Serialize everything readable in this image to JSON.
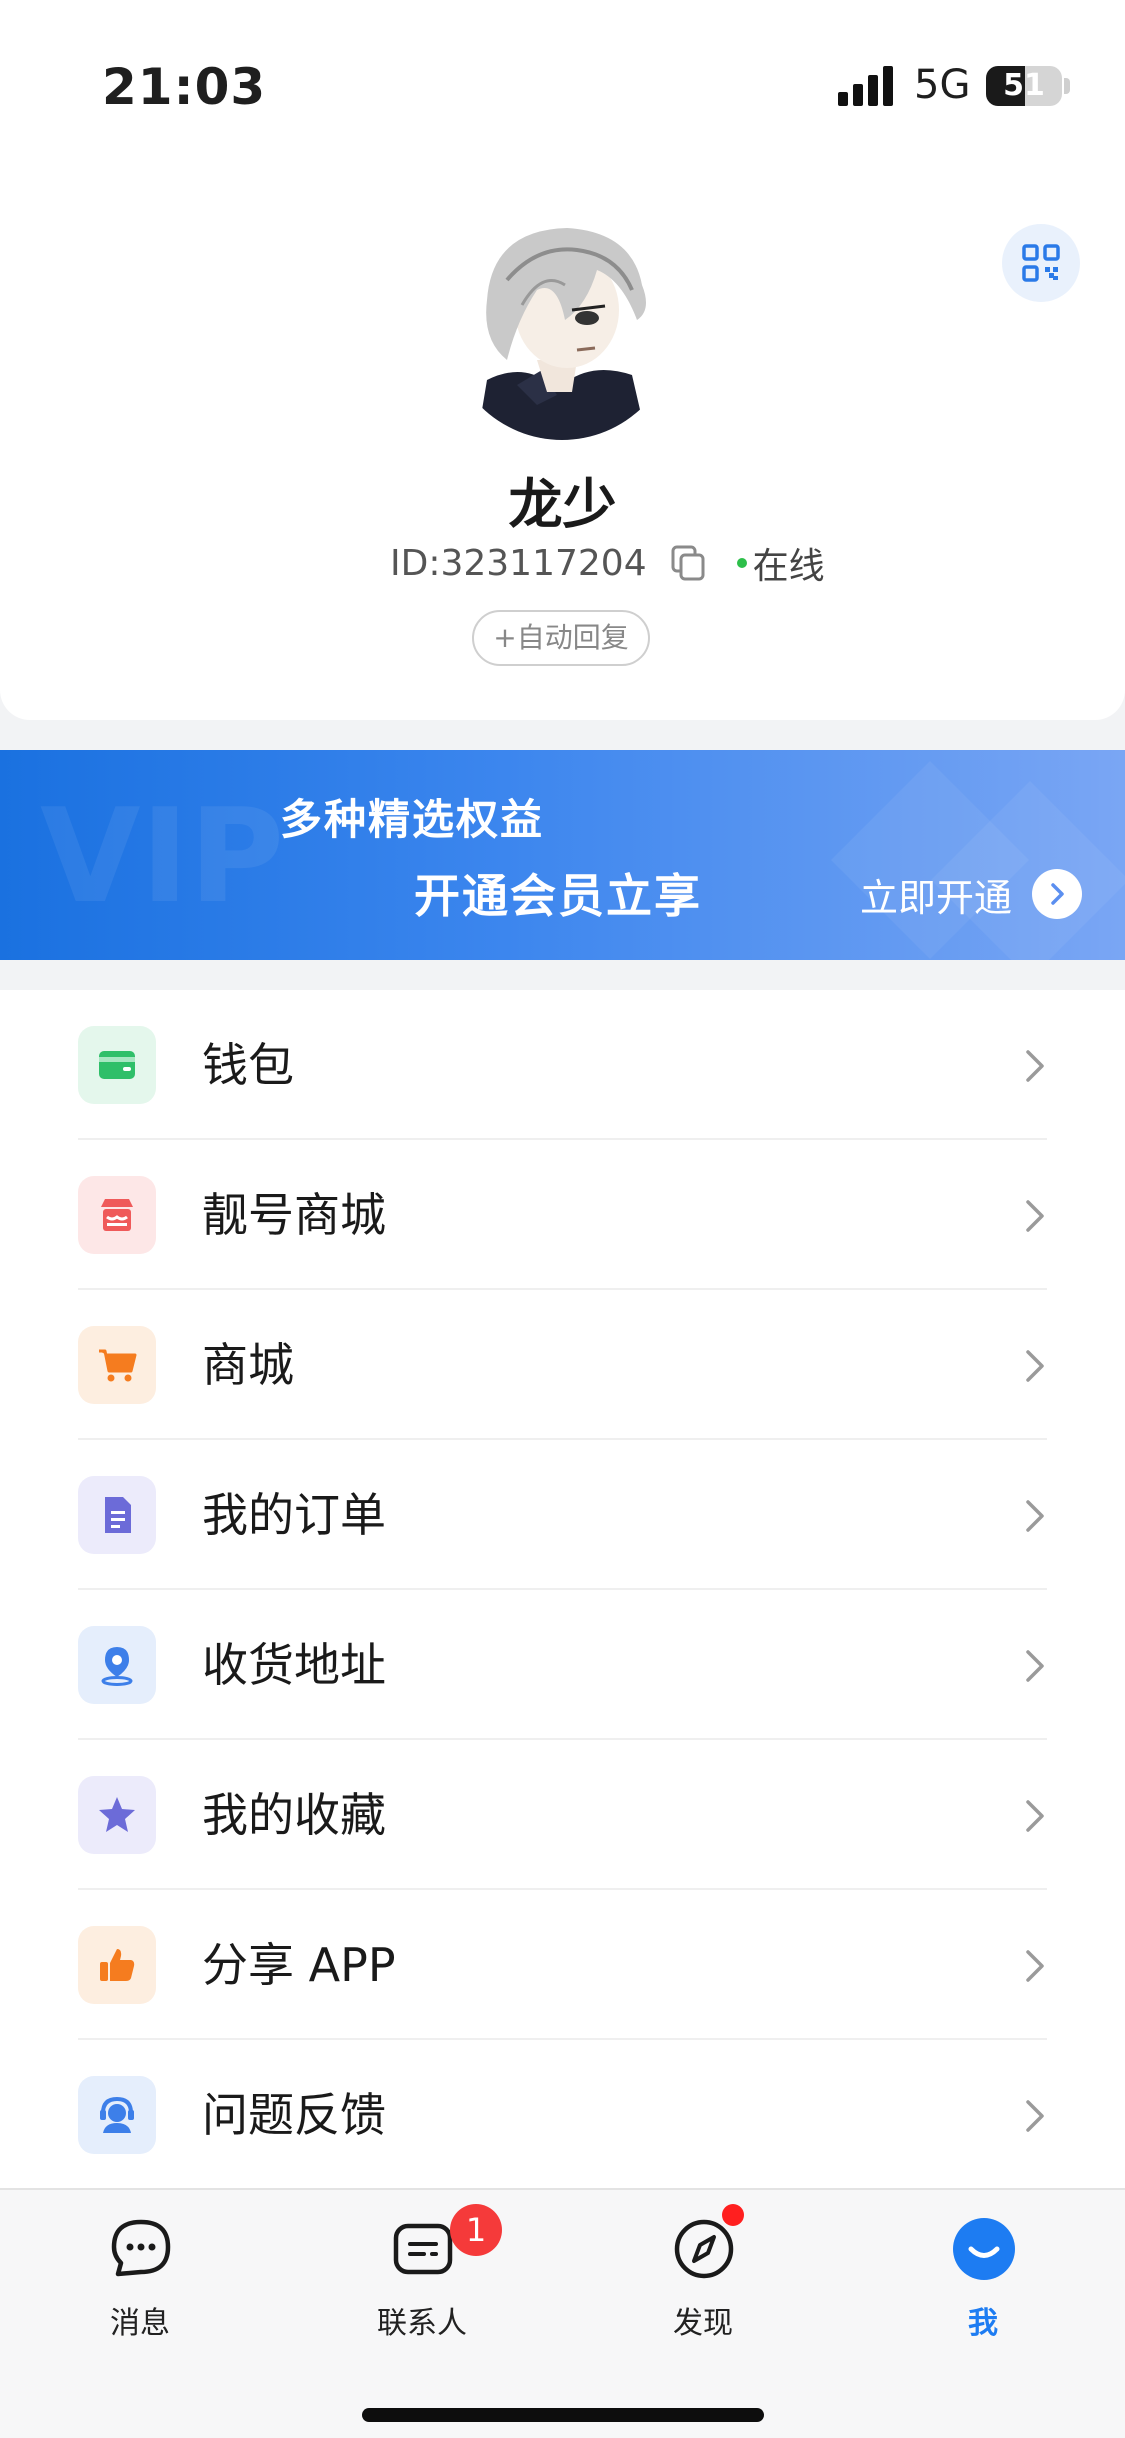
{
  "status_bar": {
    "time": "21:03",
    "network": "5G",
    "battery": "51",
    "battery_level": 0.51
  },
  "profile": {
    "name": "龙少",
    "id": "ID:323117204",
    "online_status": "在线",
    "auto_reply_label": "+自动回复"
  },
  "vip_banner": {
    "line1": "多种精选权益",
    "line2": "开通会员立享",
    "cta": "立即开通",
    "watermark": "VIP"
  },
  "menu": [
    {
      "label": "钱包",
      "icon": "wallet-icon",
      "icon_color": "#2fbf69",
      "bg": "#e4f7ec"
    },
    {
      "label": "靓号商城",
      "icon": "store-icon",
      "icon_color": "#ef5a5a",
      "bg": "#fde7e7"
    },
    {
      "label": "商城",
      "icon": "cart-icon",
      "icon_color": "#f57c1f",
      "bg": "#fdeee0"
    },
    {
      "label": "我的订单",
      "icon": "order-icon",
      "icon_color": "#6c6bd8",
      "bg": "#ecebfb"
    },
    {
      "label": "收货地址",
      "icon": "location-icon",
      "icon_color": "#3d7fe9",
      "bg": "#e5eefc"
    },
    {
      "label": "我的收藏",
      "icon": "star-icon",
      "icon_color": "#6c6bd8",
      "bg": "#ecebfb"
    },
    {
      "label": "分享 APP",
      "icon": "thumbs-up-icon",
      "icon_color": "#f57c1f",
      "bg": "#fdeee0"
    },
    {
      "label": "问题反馈",
      "icon": "support-icon",
      "icon_color": "#3d7fe9",
      "bg": "#e5eefc"
    }
  ],
  "tabbar": {
    "tabs": [
      {
        "label": "消息",
        "icon": "chat-icon"
      },
      {
        "label": "联系人",
        "icon": "contacts-icon",
        "badge": "1"
      },
      {
        "label": "发现",
        "icon": "compass-icon",
        "dot": true
      },
      {
        "label": "我",
        "icon": "me-icon",
        "active": true
      }
    ],
    "active_color": "#1d7cf2"
  }
}
